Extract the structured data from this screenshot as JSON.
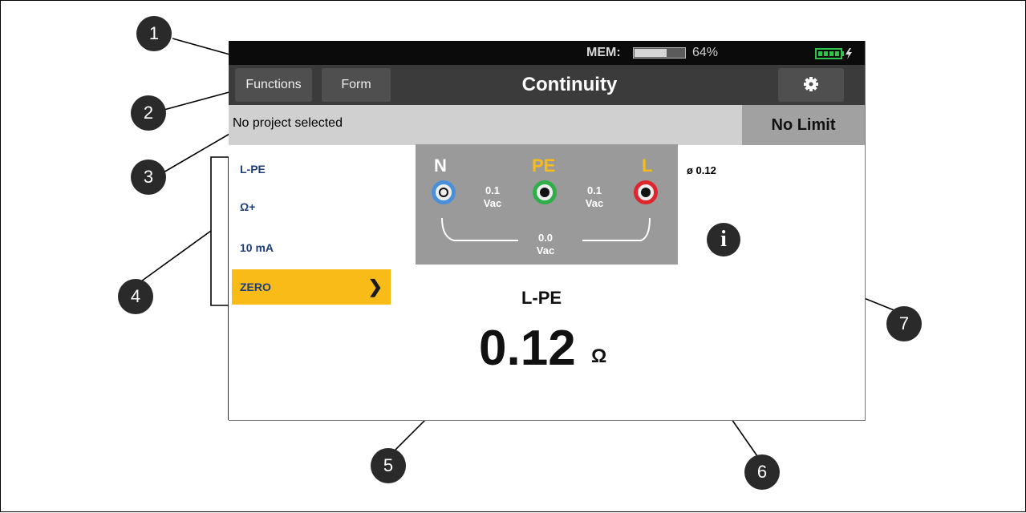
{
  "status_bar": {
    "mem_label": "MEM:",
    "mem_percent": "64%",
    "mem_fraction": 0.64,
    "battery_icon": "battery-charging-icon",
    "battery_color": "#2ec44a"
  },
  "title_bar": {
    "functions_label": "Functions",
    "form_label": "Form",
    "title": "Continuity",
    "settings_icon": "gear-icon"
  },
  "project_bar": {
    "project_text": "No project selected",
    "limit_label": "No Limit"
  },
  "options": [
    {
      "label": "L-PE"
    },
    {
      "label": "Ω+"
    },
    {
      "label": "10 mA"
    },
    {
      "label": "ZERO",
      "highlighted": true,
      "highlight_color": "#f8bb18"
    }
  ],
  "connection_diagram": {
    "terminals": [
      {
        "label": "N",
        "label_color": "#ffffff",
        "jack_color": "#4a8fd9"
      },
      {
        "label": "PE",
        "label_color": "#f8bb18",
        "jack_color": "#2fae4a"
      },
      {
        "label": "L",
        "label_color": "#f8bb18",
        "jack_color": "#e0262d"
      }
    ],
    "voltages": [
      {
        "value": "0.1",
        "unit": "Vac"
      },
      {
        "value": "0.1",
        "unit": "Vac"
      },
      {
        "value": "0.0",
        "unit": "Vac"
      }
    ]
  },
  "average_text": "ø 0.12",
  "info_icon": "info-icon",
  "measurement": {
    "label": "L-PE",
    "value": "0.12",
    "unit": "Ω"
  },
  "callouts": [
    "1",
    "2",
    "3",
    "4",
    "5",
    "6",
    "7"
  ]
}
